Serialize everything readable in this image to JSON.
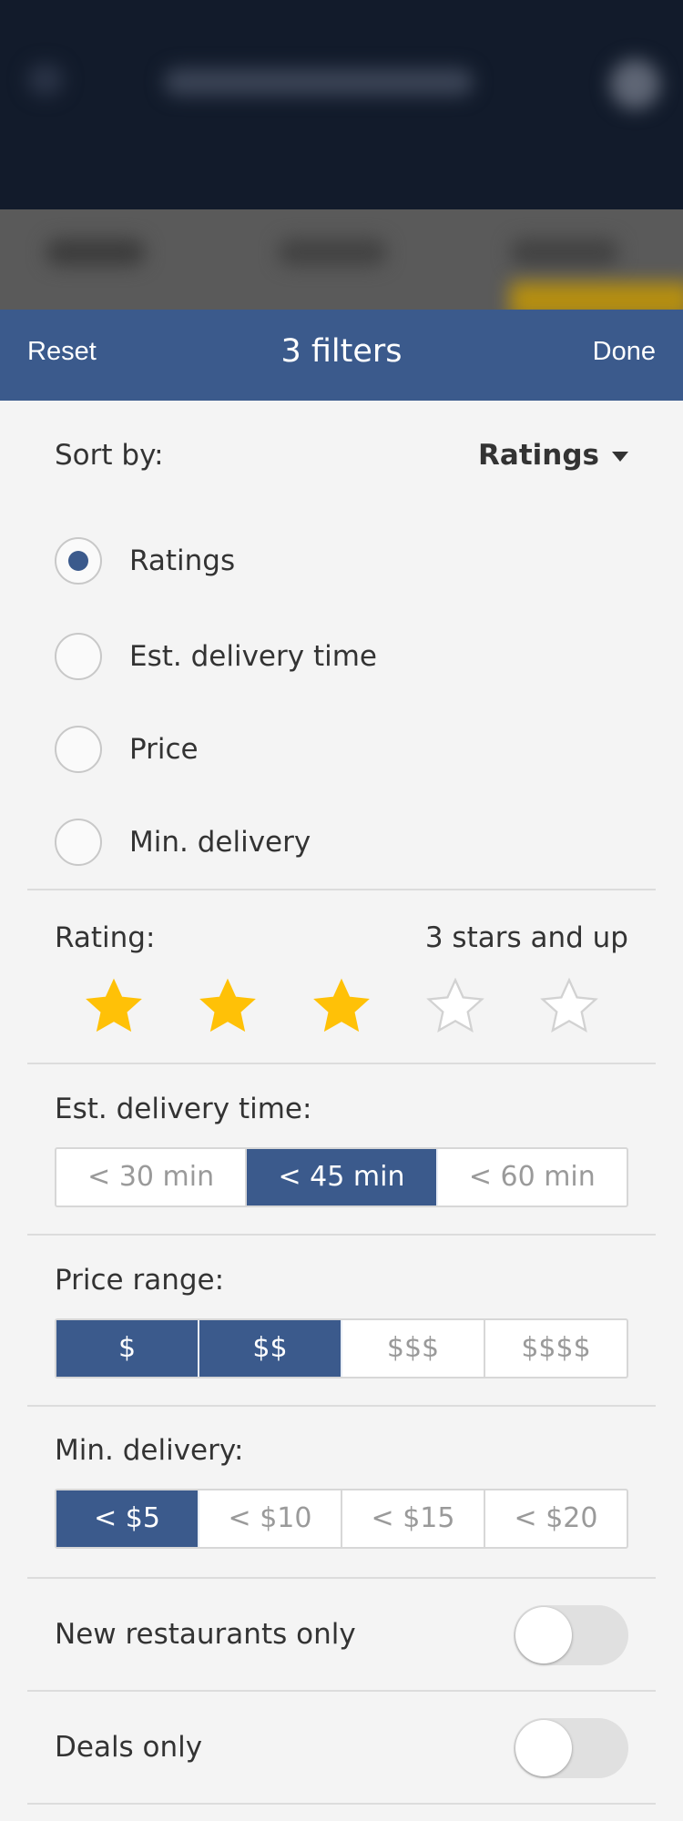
{
  "header": {
    "reset_label": "Reset",
    "title": "3 filters",
    "done_label": "Done"
  },
  "sort": {
    "label": "Sort by:",
    "selected": "Ratings",
    "options": [
      {
        "label": "Ratings",
        "selected": true
      },
      {
        "label": "Est. delivery time",
        "selected": false
      },
      {
        "label": "Price",
        "selected": false
      },
      {
        "label": "Min. delivery",
        "selected": false
      }
    ]
  },
  "rating": {
    "label": "Rating:",
    "summary": "3 stars and up",
    "value": 3,
    "max": 5
  },
  "delivery_time": {
    "label": "Est. delivery time:",
    "options": [
      {
        "label": "< 30 min",
        "selected": false
      },
      {
        "label": "< 45 min",
        "selected": true
      },
      {
        "label": "< 60 min",
        "selected": false
      }
    ]
  },
  "price_range": {
    "label": "Price range:",
    "options": [
      {
        "label": "$",
        "selected": true
      },
      {
        "label": "$$",
        "selected": true
      },
      {
        "label": "$$$",
        "selected": false
      },
      {
        "label": "$$$$",
        "selected": false
      }
    ]
  },
  "min_delivery": {
    "label": "Min. delivery:",
    "options": [
      {
        "label": "< $5",
        "selected": true
      },
      {
        "label": "< $10",
        "selected": false
      },
      {
        "label": "< $15",
        "selected": false
      },
      {
        "label": "< $20",
        "selected": false
      }
    ]
  },
  "toggles": [
    {
      "label": "New restaurants only",
      "on": false
    },
    {
      "label": "Deals only",
      "on": false
    }
  ],
  "colors": {
    "accent": "#3b5a8c",
    "star": "#ffc107",
    "background": "#f4f4f4"
  }
}
